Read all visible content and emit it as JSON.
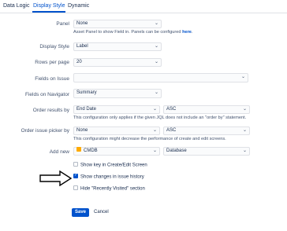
{
  "tabs": [
    "Data Logic",
    "Display Style",
    "Dynamic"
  ],
  "panel": {
    "label": "Panel",
    "value": "None",
    "help_prefix": "Asset Panel to show Field in. Panels can be configured ",
    "help_link": "here",
    "help_suffix": "."
  },
  "display_style": {
    "label": "Display Style",
    "value": "Label"
  },
  "rows_per_page": {
    "label": "Rows per page",
    "value": "20"
  },
  "fields_on_issue": {
    "label": "Fields on Issue",
    "value": ""
  },
  "fields_on_navigator": {
    "label": "Fields on Navigator",
    "value": "Summary"
  },
  "order_results": {
    "label": "Order results by",
    "field": "End Date",
    "dir": "ASC",
    "help": "This configuration only applies if the given JQL does not include an \"order by\" statement."
  },
  "order_picker": {
    "label": "Order issue picker by",
    "field": "None",
    "dir": "ASC",
    "help": "This configuration might decrease the performance of create and edit screens."
  },
  "add_new": {
    "label": "Add new",
    "type": "CMDB",
    "object": "Database"
  },
  "checkboxes": [
    {
      "label": "Show key in Create/Edit Screen",
      "checked": false
    },
    {
      "label": "Show changes in issue history",
      "checked": true
    },
    {
      "label": "Hide \"Recently Visited\" section",
      "checked": false
    }
  ],
  "buttons": {
    "save": "Save",
    "cancel": "Cancel"
  },
  "colors": {
    "accent": "#0052cc",
    "border": "#dfe1e6"
  }
}
